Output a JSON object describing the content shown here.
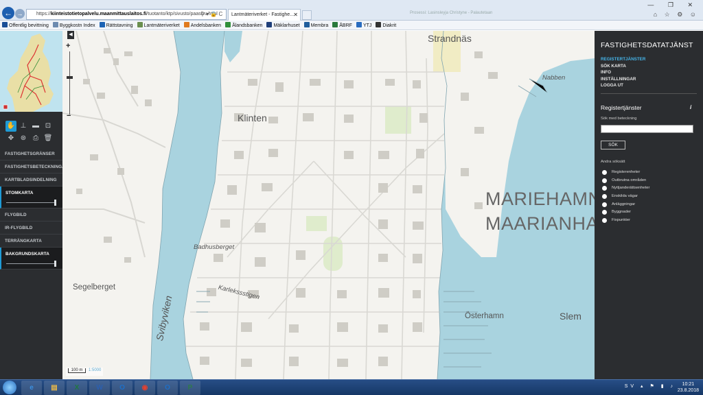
{
  "browser": {
    "address_prefix": "https://",
    "address_domain": "kiinteistotietopalvelu.maanmittauslaitos.fi",
    "address_path": "/tuotanto/ktp/sivusto/paasivu.html",
    "addr_icons": "⚲ ▾ 🔒 C",
    "tab_title": "Lantmäteriverket - Fastighe...",
    "ghost_title": "Prosessi: Lasinsleyja Christyne - Palautetaan",
    "window_controls": "— ❐ ✕",
    "toolbar_icons": "⌂ ☆ ⚙ ☺"
  },
  "favorites": [
    {
      "label": "Offentlig bevittning",
      "color": "#1a4e96"
    },
    {
      "label": "Byggkostn Index",
      "color": "#6c8bb0"
    },
    {
      "label": "Rättstavning",
      "color": "#1d63b4"
    },
    {
      "label": "Lantmäteriverket",
      "color": "#6a8f4f"
    },
    {
      "label": "Andelsbanken",
      "color": "#e07a1f"
    },
    {
      "label": "Ålandsbanken",
      "color": "#2f8f3a"
    },
    {
      "label": "Mäklarhuset",
      "color": "#1e3f7a"
    },
    {
      "label": "Membra",
      "color": "#1f5d9c"
    },
    {
      "label": "ÅBRF",
      "color": "#2a7a3c"
    },
    {
      "label": "YTJ",
      "color": "#2a6cbf"
    },
    {
      "label": "Diakrit",
      "color": "#333333"
    }
  ],
  "left_panel": {
    "layers": [
      {
        "label": "FASTIGHETSGRÄNSER",
        "on": false
      },
      {
        "label": "FASTIGHETSBETECKNINGAR",
        "on": false
      },
      {
        "label": "KARTBLADSINDELNING",
        "on": false
      },
      {
        "label": "STOMKARTA",
        "on": true
      },
      {
        "label": "FLYGBILD",
        "on": false
      },
      {
        "label": "IR-FLYGBILD",
        "on": false
      },
      {
        "label": "TERRÄNGKARTA",
        "on": false
      },
      {
        "label": "BAKGRUNDSKARTA",
        "on": true
      }
    ]
  },
  "map": {
    "labels": [
      {
        "text": "Strandnäs",
        "size": "large",
        "italic": false
      },
      {
        "text": "Nabben",
        "size": "small",
        "italic": true
      },
      {
        "text": "Klinten",
        "size": "large",
        "italic": false
      },
      {
        "text": "MARIEHAMN",
        "size": "huge",
        "italic": false
      },
      {
        "text": "MAARIANHAMINA",
        "size": "huge",
        "italic": false
      },
      {
        "text": "Badhusberget",
        "size": "small",
        "italic": true
      },
      {
        "text": "Segelberget",
        "size": "medium",
        "italic": false
      },
      {
        "text": "Svibyviken",
        "size": "large",
        "italic": true
      },
      {
        "text": "Karlekssstigen",
        "size": "small",
        "italic": true
      },
      {
        "text": "Österhamn",
        "size": "medium",
        "italic": false
      },
      {
        "text": "Slem",
        "size": "large",
        "italic": false
      }
    ],
    "scale_label": "100 m",
    "scale_sub": "1:5000"
  },
  "right_panel": {
    "title": "FASTIGHETSDATATJÄNST",
    "menu": [
      {
        "label": "REGISTERTJÄNSTER",
        "active": true
      },
      {
        "label": "SÖK KARTA",
        "active": false
      },
      {
        "label": "INFO",
        "active": false
      },
      {
        "label": "INSTÄLLNINGAR",
        "active": false
      },
      {
        "label": "LOGGA UT",
        "active": false
      }
    ],
    "section_title": "Registertjänster",
    "search_label": "Sök med beteckning",
    "search_value": "",
    "search_button": "SÖK",
    "other_label": "Andra söksätt",
    "options": [
      "Registerenheter",
      "Outbrutna områden",
      "Nyttjanderättsenheter",
      "Enskilda vägar",
      "Anläggningar",
      "Byggnader",
      "Fixpunkter"
    ]
  },
  "taskbar": {
    "apps": [
      {
        "glyph": "e",
        "color": "#3b8fe0",
        "name": "internet-explorer"
      },
      {
        "glyph": "▤",
        "color": "#e8b84a",
        "name": "file-explorer"
      },
      {
        "glyph": "X",
        "color": "#1f7a3f",
        "name": "excel"
      },
      {
        "glyph": "W",
        "color": "#2b5fb0",
        "name": "word"
      },
      {
        "glyph": "O",
        "color": "#1e6fc8",
        "name": "outlook"
      },
      {
        "glyph": "◉",
        "color": "#e4412f",
        "name": "chrome"
      },
      {
        "glyph": "O",
        "color": "#1e6fc8",
        "name": "outlook-2"
      },
      {
        "glyph": "P",
        "color": "#2f7a4a",
        "name": "publisher"
      }
    ],
    "lang": "SV",
    "time": "10:21",
    "date": "23.8.2018"
  }
}
